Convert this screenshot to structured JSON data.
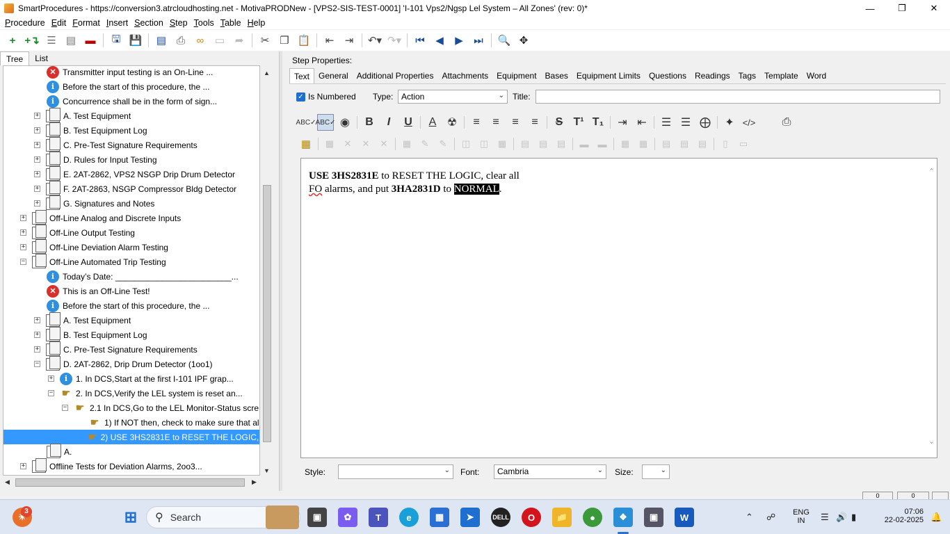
{
  "window": {
    "title": "SmartProcedures - https://conversion3.atrcloudhosting.net - MotivaPRODNew - [VPS2-SIS-TEST-0001] 'I-101 Vps2/Ngsp Lel System – All Zones' (rev: 0)*",
    "minimize": "—",
    "maximize": "❐",
    "close": "✕"
  },
  "menu": {
    "items": [
      {
        "key": "P",
        "rest": "rocedure"
      },
      {
        "key": "E",
        "rest": "dit"
      },
      {
        "key": "F",
        "rest": "ormat"
      },
      {
        "key": "I",
        "rest": "nsert"
      },
      {
        "key": "S",
        "rest": "ection"
      },
      {
        "key": "S",
        "rest": "tep"
      },
      {
        "key": "T",
        "rest": "ools"
      },
      {
        "key": "T",
        "rest": "able"
      },
      {
        "key": "H",
        "rest": "elp"
      }
    ]
  },
  "left": {
    "tabs": [
      "Tree",
      "List"
    ],
    "tree": [
      {
        "icon": "error",
        "text": "Transmitter input testing is an On-Line ..."
      },
      {
        "icon": "info",
        "text": "Before the start of this procedure, the ..."
      },
      {
        "icon": "info",
        "text": "Concurrence shall be in the form of sign..."
      },
      {
        "icon": "doc",
        "text": "A. Test Equipment"
      },
      {
        "icon": "doc",
        "text": "B. Test Equipment Log"
      },
      {
        "icon": "doc",
        "text": "C. Pre-Test Signature Requirements"
      },
      {
        "icon": "doc",
        "text": "D. Rules for Input Testing"
      },
      {
        "icon": "doc",
        "text": "E. 2AT-2862, VPS2 NSGP Drip Drum Detector"
      },
      {
        "icon": "doc",
        "text": "F. 2AT-2863, NSGP Compressor Bldg Detector"
      },
      {
        "icon": "doc",
        "text": "G. Signatures and Notes"
      },
      {
        "icon": "doc",
        "text": "Off-Line Analog and Discrete Inputs"
      },
      {
        "icon": "doc",
        "text": "Off-Line Output Testing"
      },
      {
        "icon": "doc",
        "text": "Off-Line Deviation Alarm Testing"
      },
      {
        "icon": "doc",
        "text": "Off-Line Automated Trip Testing"
      },
      {
        "icon": "info",
        "text": "Today’s Date: _________________________..."
      },
      {
        "icon": "error",
        "text": "This is an Off-Line Test!"
      },
      {
        "icon": "info",
        "text": "Before the start of this procedure, the ..."
      },
      {
        "icon": "doc",
        "text": "A. Test Equipment"
      },
      {
        "icon": "doc",
        "text": "B. Test Equipment Log"
      },
      {
        "icon": "doc",
        "text": "C. Pre-Test Signature Requirements"
      },
      {
        "icon": "doc",
        "text": "D. 2AT-2862, Drip Drum Detector (1oo1)"
      },
      {
        "icon": "info",
        "text": "1. In DCS,Start at the first I-101 IPF grap..."
      },
      {
        "icon": "hand",
        "text": "2. In DCS,Verify the LEL system is reset an..."
      },
      {
        "icon": "hand",
        "text": "2.1 In DCS,Go to the LEL Monitor-Status scre..."
      },
      {
        "icon": "hand",
        "text": "1) If NOT then, check to make sure that al..."
      },
      {
        "icon": "hand",
        "text": "2) USE 3HS2831E to RESET THE LOGIC, cl..."
      },
      {
        "icon": "doc",
        "text": "A."
      },
      {
        "icon": "doc",
        "text": "Offline Tests for Deviation Alarms, 2oo3..."
      }
    ]
  },
  "right": {
    "header": "Step Properties:",
    "tabs": [
      "Text",
      "General",
      "Additional Properties",
      "Attachments",
      "Equipment",
      "Bases",
      "Equipment Limits",
      "Questions",
      "Readings",
      "Tags",
      "Template",
      "Word"
    ],
    "is_numbered_label": "Is Numbered",
    "is_numbered_check": "✓",
    "type_label": "Type:",
    "type_value": "Action",
    "title_label": "Title:",
    "editor": {
      "bold1": "USE 3HS2831E",
      "t1": " to RESET THE LOGIC, clear all",
      "fo": "FO",
      "t2": " alarms, and put ",
      "bold2": "3HA2831D",
      "t3": " to ",
      "highlighted": "NORMAL",
      "t4": "."
    },
    "style_label": "Style:",
    "font_label": "Font:",
    "font_value": "Cambria",
    "size_label": "Size:"
  },
  "statusbar": {
    "box1": "0",
    "box2": "0"
  },
  "taskbar": {
    "search_label": "Search",
    "badge_count": "3",
    "lang1": "ENG",
    "lang2": "IN",
    "time": "07:06",
    "date": "22-02-2025"
  }
}
